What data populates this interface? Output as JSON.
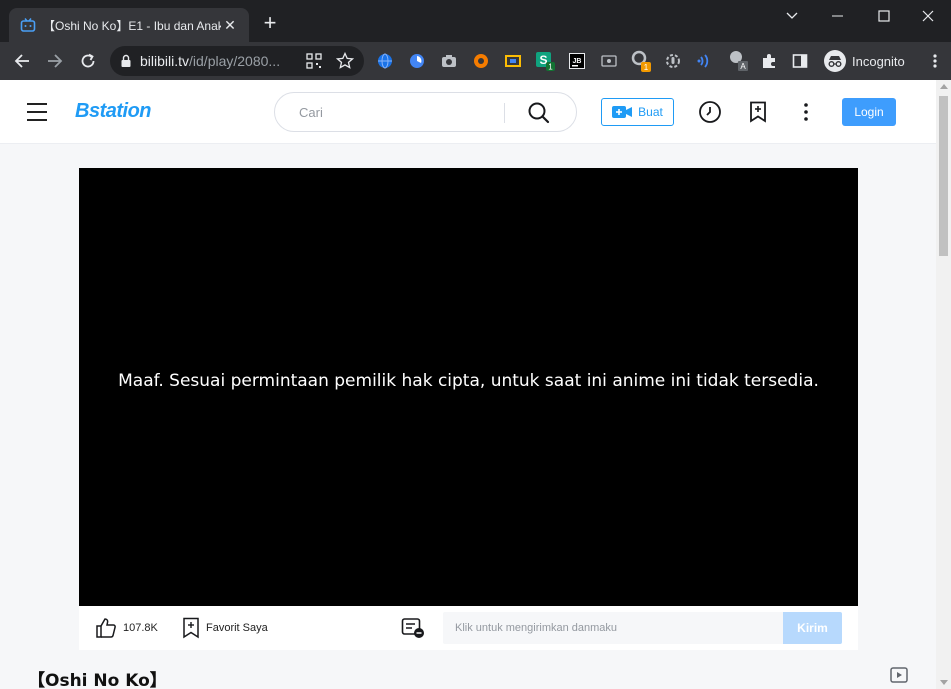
{
  "browser": {
    "tab_title": "【Oshi No Ko】E1 - Ibu dan Anak",
    "url_main": "bilibili.tv",
    "url_path": "/id/play/2080...",
    "profile_label": "Incognito",
    "extensions": [
      {
        "icon": "globe-icon",
        "color": "#1a73e8"
      },
      {
        "icon": "spiral-icon",
        "color": "#4285f4"
      },
      {
        "icon": "camera-icon",
        "color": "#bdc1c6"
      },
      {
        "icon": "lifebuoy-icon",
        "color": "#f57c00"
      },
      {
        "icon": "screen-capture-icon",
        "color": "#fbbc04"
      },
      {
        "icon": "s-badge-icon",
        "color": "#10a37f",
        "badge": "1"
      },
      {
        "icon": "jb-icon",
        "color": "#e8eaed"
      },
      {
        "icon": "card-icon",
        "color": "#bdc1c6"
      },
      {
        "icon": "magnifier-badge-icon",
        "color": "#bdc1c6",
        "badge": "1"
      },
      {
        "icon": "gear-mic-icon",
        "color": "#bdc1c6"
      },
      {
        "icon": "wireless-icon",
        "color": "#4285f4"
      },
      {
        "icon": "translate-icon",
        "color": "#bdc1c6",
        "badge": "A"
      },
      {
        "icon": "puzzle-icon",
        "color": "#e8eaed"
      },
      {
        "icon": "side-panel-icon",
        "color": "#e8eaed"
      }
    ]
  },
  "site": {
    "logo": "Bstation",
    "search_placeholder": "Cari",
    "create_label": "Buat",
    "login_label": "Login",
    "accent": "#1f9bf5"
  },
  "player": {
    "message": "Maaf. Sesuai permintaan pemilik hak cipta, untuk saat ini anime ini tidak tersedia."
  },
  "actions": {
    "likes": "107.8K",
    "favorite_label": "Favorit Saya",
    "danmaku_placeholder": "Klik untuk mengirimkan danmaku",
    "send_label": "Kirim"
  },
  "episode": {
    "title": "【Oshi No Ko】"
  }
}
